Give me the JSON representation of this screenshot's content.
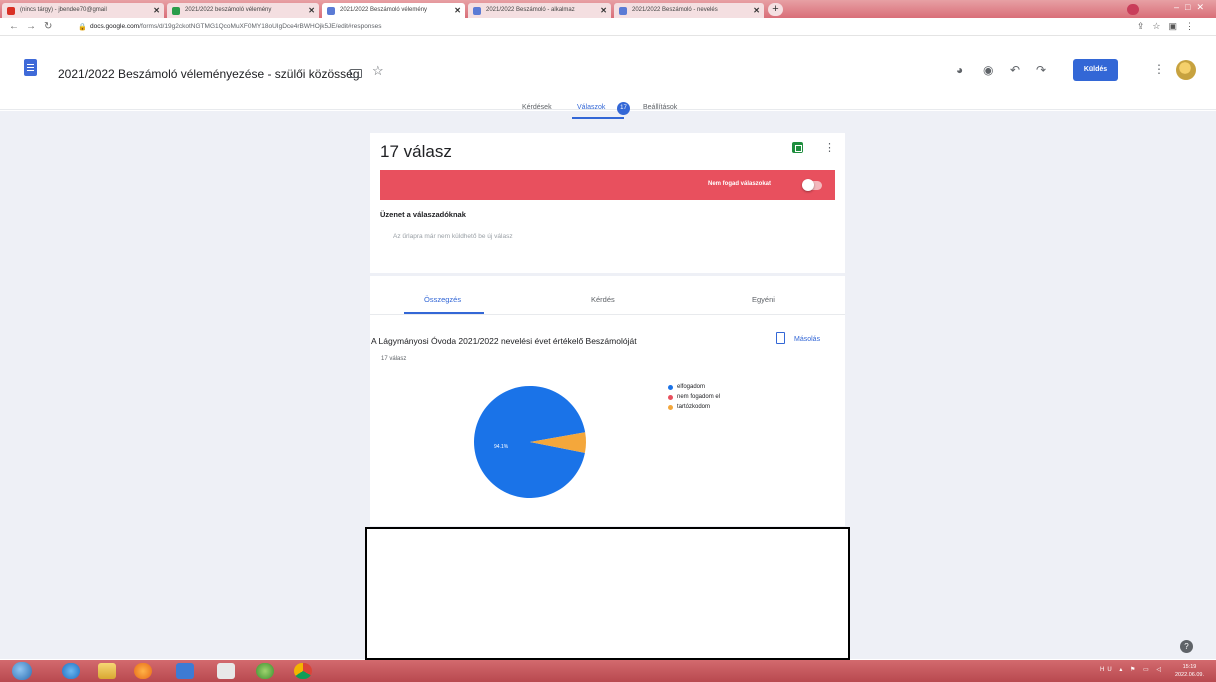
{
  "browser": {
    "tabs": [
      {
        "label": "(nincs tárgy) - jbendee70@gmail",
        "icon": "gmail-icon"
      },
      {
        "label": "2021/2022 beszámoló vélemény",
        "icon": "drive-icon"
      },
      {
        "label": "2021/2022 Beszámoló vélemény",
        "icon": "forms-icon",
        "active": true
      },
      {
        "label": "2021/2022 Beszámoló - alkalmaz",
        "icon": "forms-icon"
      },
      {
        "label": "2021/2022 Beszámoló - nevelés",
        "icon": "forms-icon"
      }
    ],
    "new_tab": "+",
    "url_host": "docs.google.com",
    "url_path": "/forms/d/19g2ckotNGTMG1QcoMuXF0MY18oUIgDce4rBWHOjk5JE/edit#responses"
  },
  "header": {
    "form_title": "2021/2022 Beszámoló véleményezése - szülői közösség",
    "send_label": "Küldés"
  },
  "form_tabs": {
    "questions": "Kérdések",
    "responses": "Válaszok",
    "responses_count": "17",
    "settings": "Beállítások"
  },
  "responses": {
    "count_title": "17 válasz",
    "accepting_label": "Nem fogad válaszokat",
    "message_label": "Üzenet a válaszadóknak",
    "message_text": "Az űrlapra már nem küldhető be új válasz"
  },
  "summary": {
    "tabs": [
      "Összegzés",
      "Kérdés",
      "Egyéni"
    ],
    "question_title": "A Lágymányosi Óvoda 2021/2022 nevelési évet értékelő Beszámolóját",
    "question_count": "17 válasz",
    "copy_label": "Másolás",
    "pie_label": "94.1%"
  },
  "chart_data": {
    "type": "pie",
    "categories": [
      "elfogadom",
      "nem fogadom el",
      "tartózkodom"
    ],
    "values": [
      94.1,
      0,
      5.9
    ],
    "colors": [
      "#1a73e8",
      "#e8505e",
      "#f4a73b"
    ],
    "legend_position": "right"
  },
  "taskbar": {
    "lang": "HU",
    "time": "15:19",
    "date": "2022.06.09."
  }
}
